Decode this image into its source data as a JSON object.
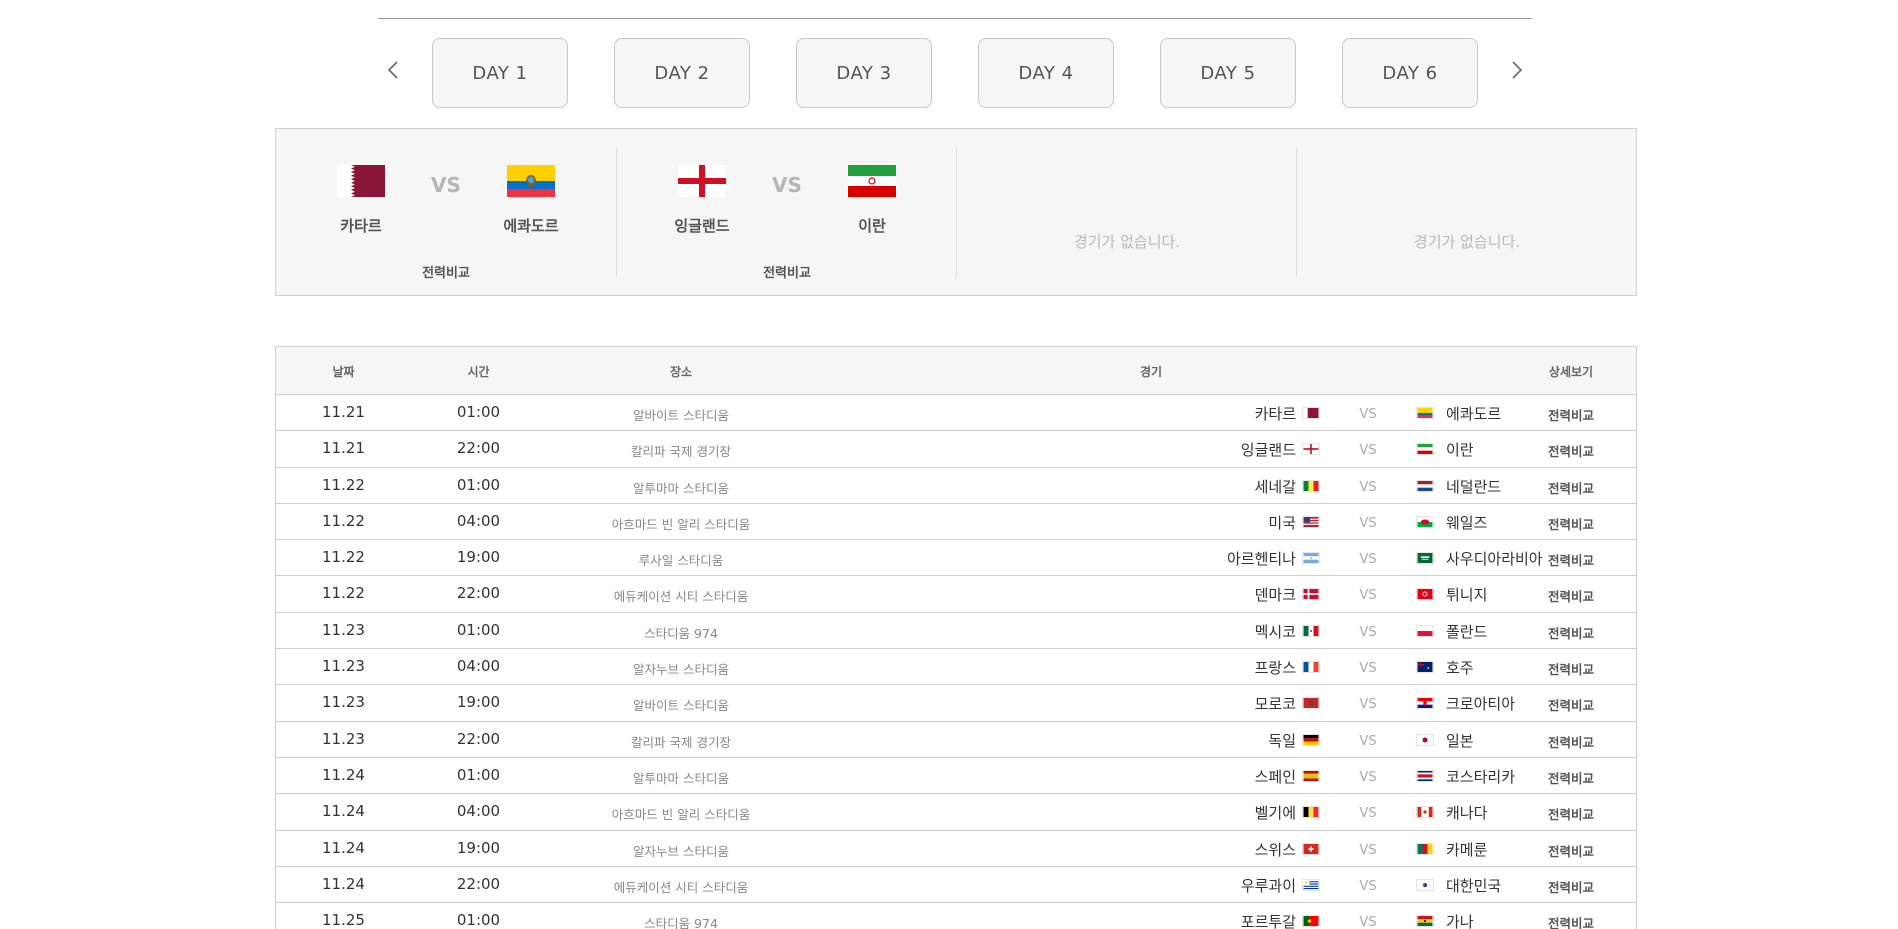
{
  "day_tabs": [
    "DAY 1",
    "DAY 2",
    "DAY 3",
    "DAY 4",
    "DAY 5",
    "DAY 6"
  ],
  "featured": [
    {
      "home": "카타르",
      "away": "에콰도르",
      "vs": "VS",
      "compare": "전력비교",
      "home_flag": "qatar-flag-icon",
      "away_flag": "ecuador-flag-icon"
    },
    {
      "home": "잉글랜드",
      "away": "이란",
      "vs": "VS",
      "compare": "전력비교",
      "home_flag": "england-flag-icon",
      "away_flag": "iran-flag-icon"
    },
    {
      "empty": "경기가 없습니다."
    },
    {
      "empty": "경기가 없습니다."
    }
  ],
  "table": {
    "headers": {
      "date": "날짜",
      "time": "시간",
      "venue": "장소",
      "match": "경기",
      "detail": "상세보기"
    },
    "vs_label": "VS",
    "rows": [
      {
        "date": "11.21",
        "time": "01:00",
        "venue": "알바이트 스타디움",
        "home": "카타르",
        "away": "에콰도르",
        "detail": "전력비교",
        "hf": "qa",
        "af": "ec"
      },
      {
        "date": "11.21",
        "time": "22:00",
        "venue": "칼리파 국제 경기장",
        "home": "잉글랜드",
        "away": "이란",
        "detail": "전력비교",
        "hf": "en",
        "af": "ir"
      },
      {
        "date": "11.22",
        "time": "01:00",
        "venue": "알투마마 스타디움",
        "home": "세네갈",
        "away": "네덜란드",
        "detail": "전력비교",
        "hf": "sn",
        "af": "nl"
      },
      {
        "date": "11.22",
        "time": "04:00",
        "venue": "아흐마드 빈 알리 스타디움",
        "home": "미국",
        "away": "웨일즈",
        "detail": "전력비교",
        "hf": "us",
        "af": "wl"
      },
      {
        "date": "11.22",
        "time": "19:00",
        "venue": "루사일 스타디움",
        "home": "아르헨티나",
        "away": "사우디아라비아",
        "detail": "전력비교",
        "hf": "ar",
        "af": "sa"
      },
      {
        "date": "11.22",
        "time": "22:00",
        "venue": "에듀케이션 시티 스타디움",
        "home": "덴마크",
        "away": "튀니지",
        "detail": "전력비교",
        "hf": "dk",
        "af": "tn"
      },
      {
        "date": "11.23",
        "time": "01:00",
        "venue": "스타디움 974",
        "home": "멕시코",
        "away": "폴란드",
        "detail": "전력비교",
        "hf": "mx",
        "af": "pl"
      },
      {
        "date": "11.23",
        "time": "04:00",
        "venue": "알자누브 스타디움",
        "home": "프랑스",
        "away": "호주",
        "detail": "전력비교",
        "hf": "fr",
        "af": "au"
      },
      {
        "date": "11.23",
        "time": "19:00",
        "venue": "알바이트 스타디움",
        "home": "모로코",
        "away": "크로아티아",
        "detail": "전력비교",
        "hf": "ma",
        "af": "hr"
      },
      {
        "date": "11.23",
        "time": "22:00",
        "venue": "칼리파 국제 경기장",
        "home": "독일",
        "away": "일본",
        "detail": "전력비교",
        "hf": "de",
        "af": "jp"
      },
      {
        "date": "11.24",
        "time": "01:00",
        "venue": "알투마마 스타디움",
        "home": "스페인",
        "away": "코스타리카",
        "detail": "전력비교",
        "hf": "es",
        "af": "cr"
      },
      {
        "date": "11.24",
        "time": "04:00",
        "venue": "아흐마드 빈 알리 스타디움",
        "home": "벨기에",
        "away": "캐나다",
        "detail": "전력비교",
        "hf": "be",
        "af": "ca"
      },
      {
        "date": "11.24",
        "time": "19:00",
        "venue": "알자누브 스타디움",
        "home": "스위스",
        "away": "카메룬",
        "detail": "전력비교",
        "hf": "ch",
        "af": "cm"
      },
      {
        "date": "11.24",
        "time": "22:00",
        "venue": "에듀케이션 시티 스타디움",
        "home": "우루과이",
        "away": "대한민국",
        "detail": "전력비교",
        "hf": "uy",
        "af": "kr"
      },
      {
        "date": "11.25",
        "time": "01:00",
        "venue": "스타디움 974",
        "home": "포르투갈",
        "away": "가나",
        "detail": "전력비교",
        "hf": "pt",
        "af": "gh"
      }
    ]
  }
}
